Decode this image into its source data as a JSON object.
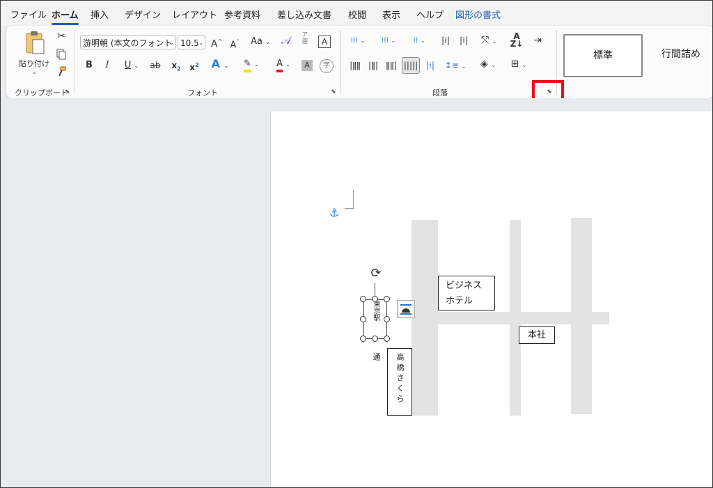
{
  "menu": {
    "file": "ファイル",
    "home": "ホーム",
    "insert": "挿入",
    "design": "デザイン",
    "layout": "レイアウト",
    "references": "参考資料",
    "mailings": "差し込み文書",
    "review": "校閲",
    "view": "表示",
    "help": "ヘルプ",
    "shape_format": "図形の書式"
  },
  "clipboard": {
    "paste_label": "貼り付け",
    "group_label": "クリップボード"
  },
  "font": {
    "font_name": "游明朝 (本文のフォント",
    "font_size": "10.5",
    "grow": "A",
    "shrink": "A",
    "case": "Aa",
    "phonetic_top": "ア",
    "phonetic_bottom": "亜",
    "box_char": "A",
    "bold": "B",
    "italic": "I",
    "underline": "U",
    "strike": "ab",
    "subscript": "x",
    "superscript": "x",
    "effects": "A",
    "font_color": "A",
    "shading": "A",
    "enclose": "字",
    "group_label": "フォント"
  },
  "paragraph": {
    "group_label": "段落"
  },
  "styles": {
    "normal": "標準",
    "no_spacing": "行間詰め"
  },
  "map": {
    "hotel_line1": "ビジネス",
    "hotel_line2": "ホテル",
    "head_office": "本社",
    "station": "東京駅",
    "street": "高橋さくら通"
  },
  "colors": {
    "accent": "#1f5fbf",
    "highlight": "#e8101a"
  }
}
